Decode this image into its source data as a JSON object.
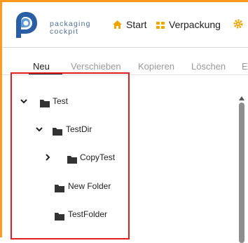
{
  "header": {
    "brand_line1": "packaging",
    "brand_line2": "cockpit",
    "nav": [
      {
        "label": "Start",
        "icon": "home-icon"
      },
      {
        "label": "Verpackung",
        "icon": "package-icon"
      },
      {
        "label": "",
        "icon": "gear-icon"
      }
    ]
  },
  "tabs": [
    {
      "label": "Neu",
      "active": true
    },
    {
      "label": "Verschieben",
      "active": false
    },
    {
      "label": "Kopieren",
      "active": false
    },
    {
      "label": "Löschen",
      "active": false
    },
    {
      "label": "E",
      "active": false
    }
  ],
  "tree": [
    {
      "label": "Test",
      "expanded": true
    },
    {
      "label": "TestDir",
      "expanded": true
    },
    {
      "label": "CopyTest",
      "expanded": false
    },
    {
      "label": "New Folder"
    },
    {
      "label": "TestFolder"
    }
  ],
  "colors": {
    "accent": "#ff9a1f",
    "selection_border": "#e02020",
    "brand_blue": "#4d6f97",
    "nav_icon_orange": "#f0a500"
  }
}
